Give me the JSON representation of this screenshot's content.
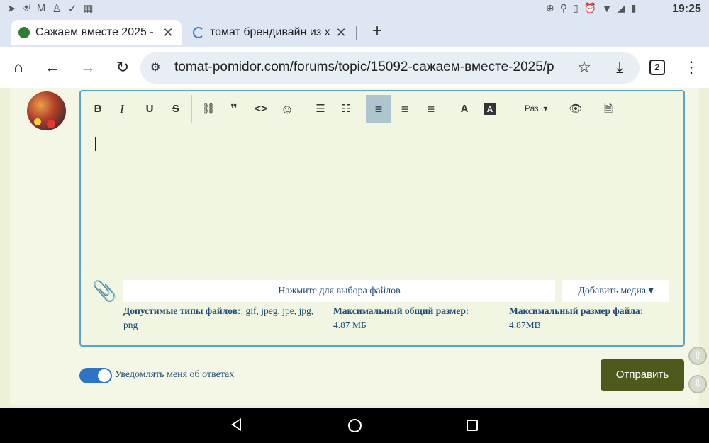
{
  "status_bar": {
    "time": "19:25",
    "left_icons": [
      "telegram-icon",
      "shield-icon",
      "gmail-icon",
      "figure-icon",
      "check-icon",
      "grid-icon"
    ],
    "right_icons": [
      "data-saver-icon",
      "location-icon",
      "vibrate-icon",
      "alarm-icon",
      "wifi-icon",
      "signal-icon",
      "battery-icon"
    ]
  },
  "tabs": [
    {
      "title": "Сажаем вместе 2025 - (",
      "active": true,
      "icon": "tomato-favicon"
    },
    {
      "title": "томат брендивайн из х",
      "active": false,
      "icon": "loading-spinner-icon"
    }
  ],
  "toolbar": {
    "url": "tomat-pomidor.com/forums/topic/15092-сажаем-вместе-2025/p",
    "tab_count": "2"
  },
  "editor": {
    "tools": [
      {
        "name": "bold-button",
        "label": "B"
      },
      {
        "name": "italic-button",
        "label": "I"
      },
      {
        "name": "underline-button",
        "label": "U"
      },
      {
        "name": "strikethrough-button",
        "label": "S"
      },
      {
        "name": "link-button",
        "label": "⛓"
      },
      {
        "name": "quote-button",
        "label": "❞"
      },
      {
        "name": "code-button",
        "label": "<>"
      },
      {
        "name": "emoji-button",
        "label": "☺"
      },
      {
        "name": "bullet-list-button",
        "label": "☰"
      },
      {
        "name": "numbered-list-button",
        "label": "☷"
      },
      {
        "name": "align-left-button",
        "label": "≡"
      },
      {
        "name": "align-center-button",
        "label": "≡"
      },
      {
        "name": "align-right-button",
        "label": "≡"
      },
      {
        "name": "text-color-button",
        "label": "A"
      },
      {
        "name": "bg-color-button",
        "label": "A"
      },
      {
        "name": "preview-button",
        "label": "👁"
      },
      {
        "name": "source-button",
        "label": "🗎"
      }
    ],
    "size_label": "Раз..▾",
    "file_chooser": "Нажмите для выбора файлов",
    "add_media": "Добавить медиа ▾",
    "allowed_types_label": "Допустимые типы файлов:",
    "allowed_types_value": ": gif, jpeg, jpe, jpg, png",
    "max_total_label": "Максимальный общий размер:",
    "max_total_value": "4.87 МБ",
    "max_file_label": "Максимальный размер файла:",
    "max_file_value": "4.87MB"
  },
  "footer": {
    "notify_label": "Уведомлять меня об ответах",
    "notify_on": true,
    "submit_label": "Отправить"
  }
}
